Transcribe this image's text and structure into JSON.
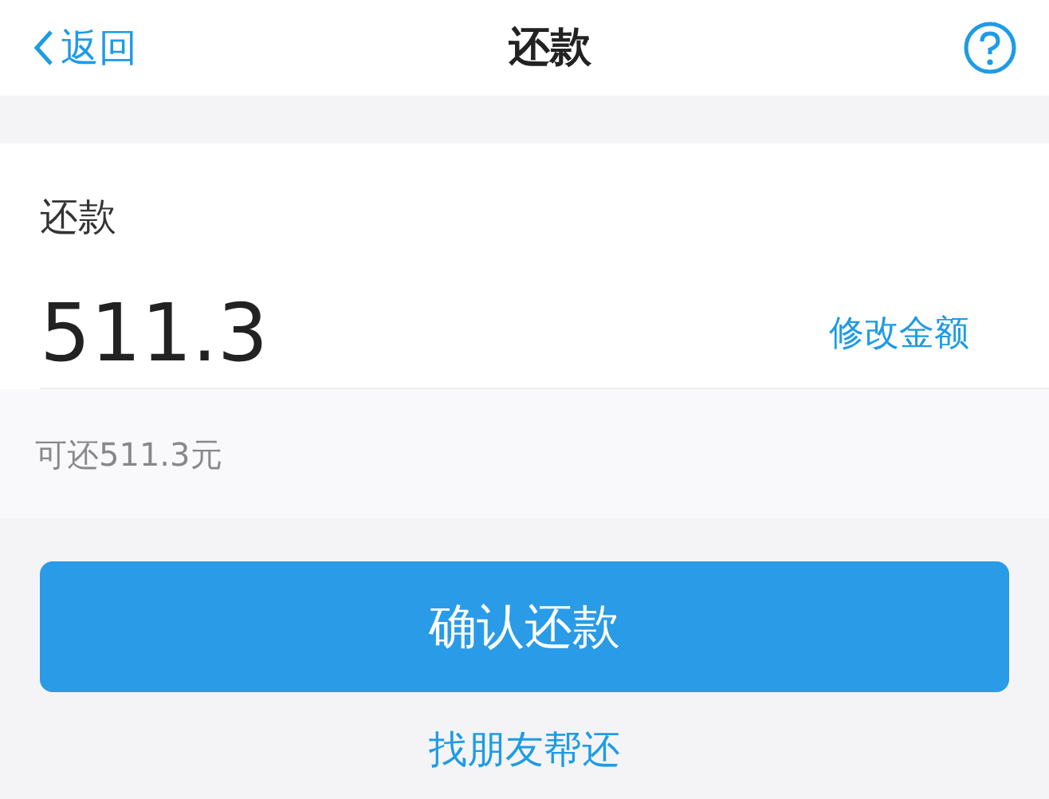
{
  "nav": {
    "back": "返回",
    "title": "还款"
  },
  "card": {
    "label": "还款",
    "amount": "511.3",
    "edit_link": "修改金额",
    "available": "可还511.3元"
  },
  "confirm_button": "确认还款",
  "friend_link": "找朋友帮还"
}
